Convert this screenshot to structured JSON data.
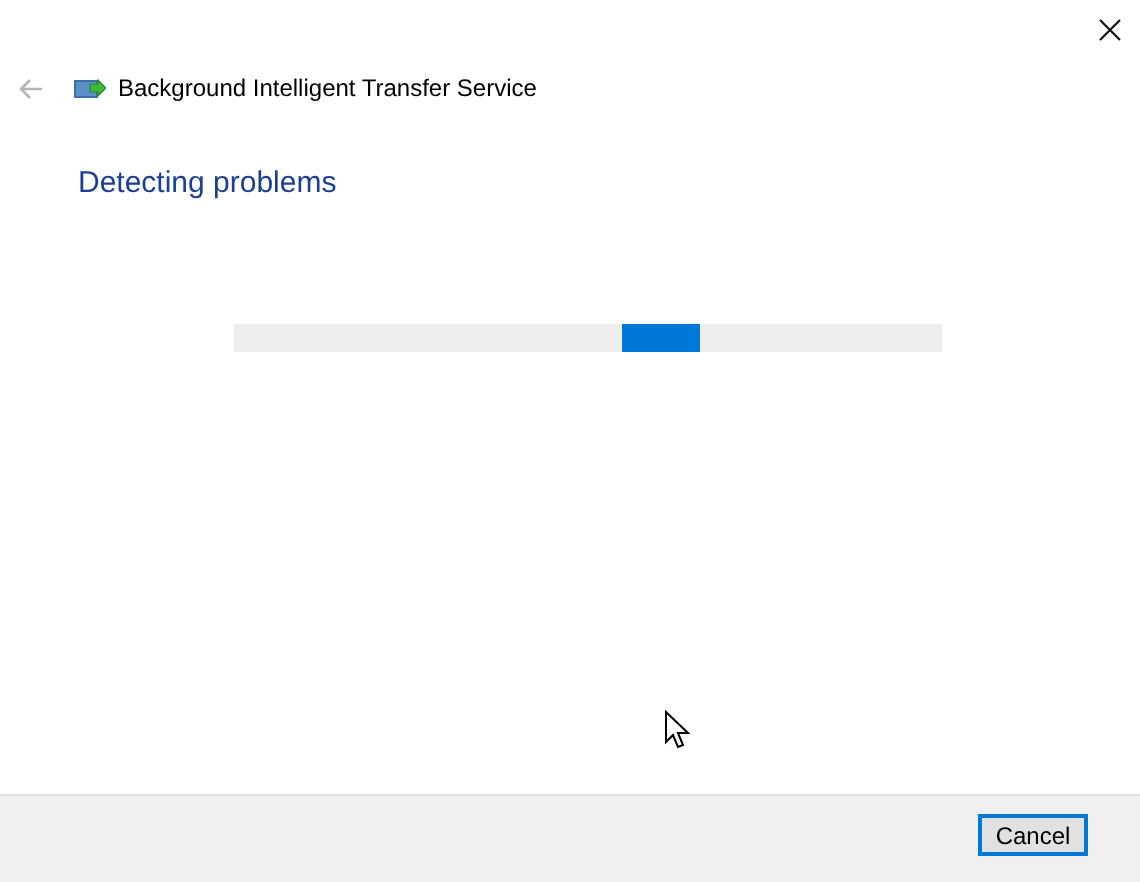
{
  "header": {
    "title": "Background Intelligent Transfer Service",
    "back_disabled": true
  },
  "heading": "Detecting problems",
  "progress": {
    "kind": "marquee"
  },
  "buttons": [
    {
      "label": "Cancel",
      "default": true
    }
  ]
}
